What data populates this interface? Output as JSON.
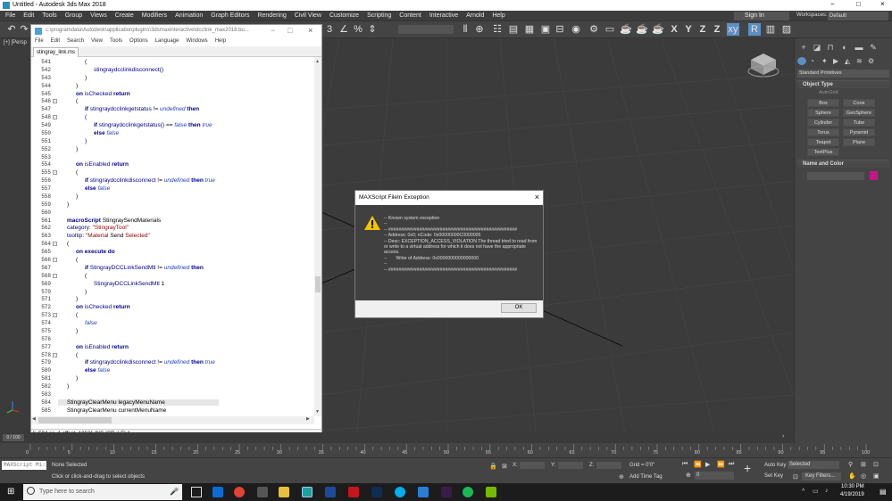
{
  "app": {
    "title": "Untitled - Autodesk 3ds Max 2018",
    "window_controls": [
      "−",
      "□",
      "×"
    ],
    "menu": [
      "File",
      "Edit",
      "Tools",
      "Group",
      "Views",
      "Create",
      "Modifiers",
      "Animation",
      "Graph Editors",
      "Rendering",
      "Civil View",
      "Customize",
      "Scripting",
      "Content",
      "Interactive",
      "Arnold",
      "Help"
    ],
    "sign_in": "Sign In",
    "workspaces_label": "Workspaces:",
    "workspaces_value": "Default",
    "viewport_label": "[+] [Persp"
  },
  "editor": {
    "title": "c:\\programdata\\Autodesk\\applicationplugins\\3dsmaxinteractive\\dcclink_max2018.bu...",
    "menu": [
      "File",
      "Edit",
      "Search",
      "View",
      "Tools",
      "Options",
      "Language",
      "Windows",
      "Help"
    ],
    "tab": "stingray_link.ms",
    "status": "li=584 co=1 offset=12621 INS (CR+LF) A",
    "lines": [
      {
        "n": "541",
        "t": "("
      },
      {
        "n": "542",
        "t": "stingraydcclinkdisconnect()"
      },
      {
        "n": "543",
        "t": ")"
      },
      {
        "n": "544",
        "t": ")"
      },
      {
        "n": "545",
        "t": "on isChecked return"
      },
      {
        "n": "546",
        "t": "("
      },
      {
        "n": "547",
        "t": "if stingraydcclinkgetstatus != undefined then"
      },
      {
        "n": "548",
        "t": "("
      },
      {
        "n": "549",
        "t": "if stingraydcclinkgetstatus() == false then true"
      },
      {
        "n": "550",
        "t": "else false"
      },
      {
        "n": "551",
        "t": ")"
      },
      {
        "n": "552",
        "t": ")"
      },
      {
        "n": "553",
        "t": ""
      },
      {
        "n": "554",
        "t": "on isEnabled return"
      },
      {
        "n": "555",
        "t": "("
      },
      {
        "n": "556",
        "t": "if stingraydcclinkdisconnect != undefined then true"
      },
      {
        "n": "557",
        "t": "else false"
      },
      {
        "n": "558",
        "t": ")"
      },
      {
        "n": "559",
        "t": ")"
      },
      {
        "n": "560",
        "t": ""
      },
      {
        "n": "561",
        "t": "macroScript StingraySendMaterials"
      },
      {
        "n": "562",
        "t": "category: \"StingrayTool\""
      },
      {
        "n": "563",
        "t": "tooltip: \"Material Send Selected\""
      },
      {
        "n": "564",
        "t": "("
      },
      {
        "n": "565",
        "t": "on execute do"
      },
      {
        "n": "566",
        "t": "("
      },
      {
        "n": "567",
        "t": "if StingrayDCCLinkSendMtl != undefined then"
      },
      {
        "n": "568",
        "t": "("
      },
      {
        "n": "569",
        "t": "StingrayDCCLinkSendMtl 1"
      },
      {
        "n": "570",
        "t": ")"
      },
      {
        "n": "571",
        "t": ")"
      },
      {
        "n": "572",
        "t": "on isChecked return"
      },
      {
        "n": "573",
        "t": "("
      },
      {
        "n": "574",
        "t": "false"
      },
      {
        "n": "575",
        "t": ")"
      },
      {
        "n": "576",
        "t": ""
      },
      {
        "n": "577",
        "t": "on isEnabled return"
      },
      {
        "n": "578",
        "t": "("
      },
      {
        "n": "579",
        "t": "if stingraydcclinkdisconnect != undefined then true"
      },
      {
        "n": "580",
        "t": "else false"
      },
      {
        "n": "581",
        "t": ")"
      },
      {
        "n": "582",
        "t": ")"
      },
      {
        "n": "583",
        "t": ""
      },
      {
        "n": "584",
        "t": "StingrayClearMenu legacyMenuName"
      },
      {
        "n": "585",
        "t": "StingrayClearMenu currentMenuName"
      }
    ]
  },
  "dialog": {
    "title": "MAXScript FileIn Exception",
    "message": "-- Known system exception\n--\n-- ##################################################\n-- Address: 0x0; nCode: 0x00000000C0000005\n-- Desc: EXCEPTION_ACCESS_VIOLATION The thread tried to read from or write to a virtual address for which it does not have the appropriate access.\n--       Write of Address: 0x0000000000000000\n--\n-- ##################################################",
    "ok": "OK"
  },
  "command_panel": {
    "dropdown": "Standard Primitives",
    "object_type": "Object Type",
    "autogrid": "AutoGrid",
    "buttons": [
      "Box",
      "Cone",
      "Sphere",
      "GeoSphere",
      "Cylinder",
      "Tube",
      "Torus",
      "Pyramid",
      "Teapot",
      "Plane",
      "TextPlus"
    ],
    "name_color": "Name and Color"
  },
  "timeline": {
    "frame": "0 / 100",
    "ticks": [
      "0",
      "5",
      "10",
      "15",
      "20",
      "25",
      "30",
      "35",
      "40",
      "45",
      "50",
      "55",
      "60",
      "65",
      "70",
      "75",
      "80",
      "85",
      "90",
      "95",
      "100"
    ]
  },
  "status": {
    "maxscript": "MAXScript Mi:",
    "selection": "None Selected",
    "prompt": "Click or click-and-drag to select objects",
    "x": "X:",
    "y": "Y:",
    "z": "Z:",
    "grid": "Grid = 0'0\"",
    "add_time_tag": "Add Time Tag",
    "auto_key": "Auto Key",
    "selected": "Selected",
    "set_key": "Set Key",
    "key_filters": "Key Filters...",
    "frame_value": "0"
  },
  "taskbar": {
    "search": "Type here to search",
    "time": "10:30 PM",
    "date": "4/19/2019"
  }
}
